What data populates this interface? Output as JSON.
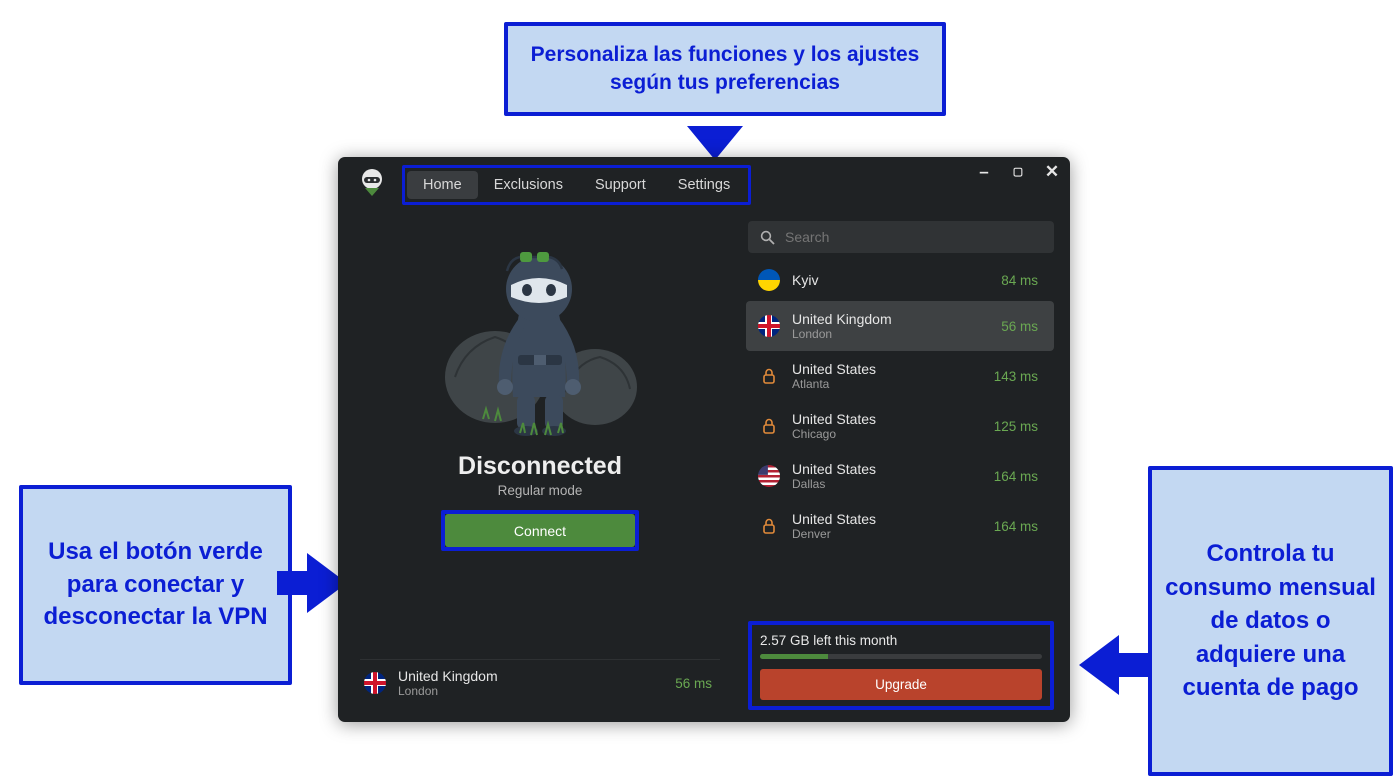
{
  "callouts": {
    "top": "Personaliza las funciones y los ajustes según tus preferencias",
    "left": "Usa el botón verde para conectar y desconectar la VPN",
    "right": "Controla tu consumo mensual de datos o adquiere una cuenta de pago"
  },
  "tabs": {
    "home": "Home",
    "exclusions": "Exclusions",
    "support": "Support",
    "settings": "Settings"
  },
  "status": {
    "title": "Disconnected",
    "subtitle": "Regular mode",
    "connect_label": "Connect"
  },
  "selected": {
    "country": "United Kingdom",
    "city": "London",
    "ping": "56 ms"
  },
  "search": {
    "placeholder": "Search"
  },
  "servers": [
    {
      "country": "Kyiv",
      "city": "",
      "ping": "84 ms",
      "icon": "ua",
      "selected": false
    },
    {
      "country": "United Kingdom",
      "city": "London",
      "ping": "56 ms",
      "icon": "uk",
      "selected": true
    },
    {
      "country": "United States",
      "city": "Atlanta",
      "ping": "143 ms",
      "icon": "lock",
      "selected": false
    },
    {
      "country": "United States",
      "city": "Chicago",
      "ping": "125 ms",
      "icon": "lock",
      "selected": false
    },
    {
      "country": "United States",
      "city": "Dallas",
      "ping": "164 ms",
      "icon": "us",
      "selected": false
    },
    {
      "country": "United States",
      "city": "Denver",
      "ping": "164 ms",
      "icon": "lock",
      "selected": false
    }
  ],
  "data_panel": {
    "label": "2.57 GB left this month",
    "upgrade_label": "Upgrade"
  }
}
